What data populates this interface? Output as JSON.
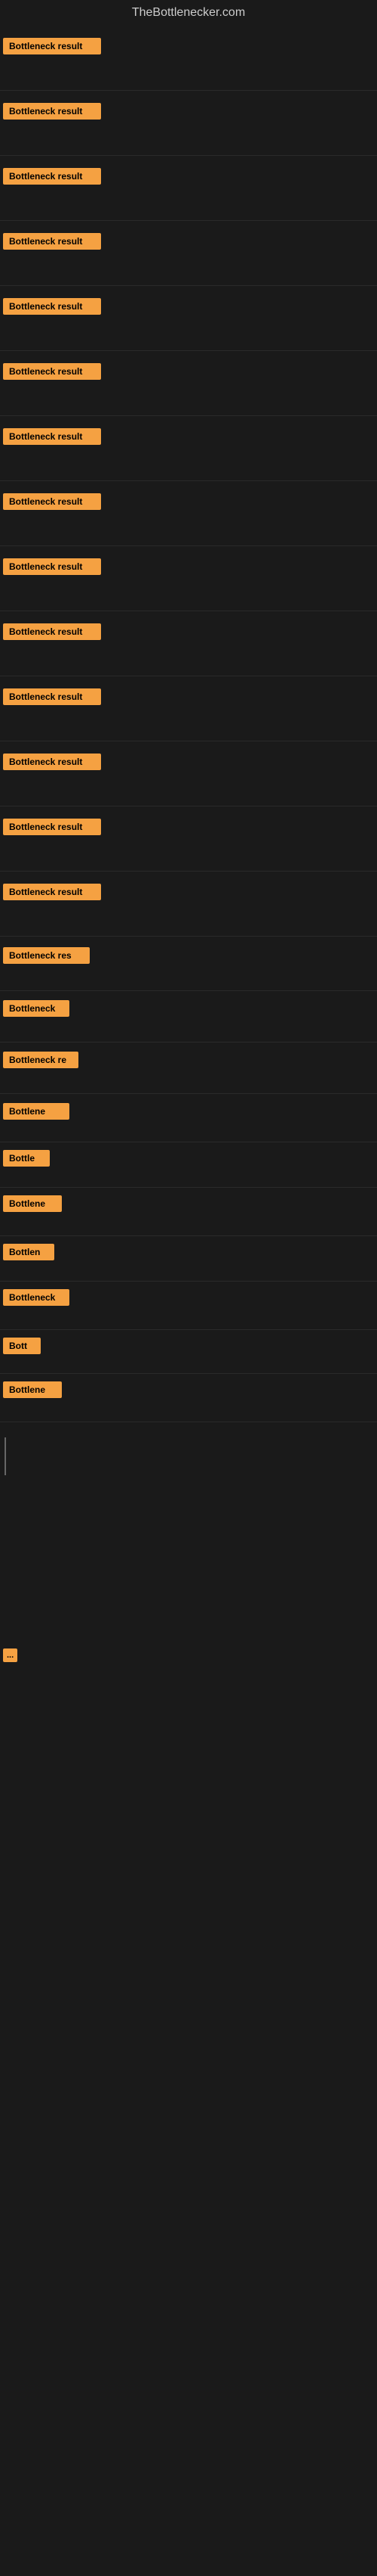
{
  "site": {
    "title": "TheBottlenecker.com"
  },
  "items": [
    {
      "id": 1,
      "label": "Bottleneck result",
      "class": "item-1",
      "height": 86
    },
    {
      "id": 2,
      "label": "Bottleneck result",
      "class": "item-2",
      "height": 86
    },
    {
      "id": 3,
      "label": "Bottleneck result",
      "class": "item-3",
      "height": 86
    },
    {
      "id": 4,
      "label": "Bottleneck result",
      "class": "item-4",
      "height": 86
    },
    {
      "id": 5,
      "label": "Bottleneck result",
      "class": "item-5",
      "height": 86
    },
    {
      "id": 6,
      "label": "Bottleneck result",
      "class": "item-6",
      "height": 86
    },
    {
      "id": 7,
      "label": "Bottleneck result",
      "class": "item-7",
      "height": 86
    },
    {
      "id": 8,
      "label": "Bottleneck result",
      "class": "item-8",
      "height": 86
    },
    {
      "id": 9,
      "label": "Bottleneck result",
      "class": "item-9",
      "height": 86
    },
    {
      "id": 10,
      "label": "Bottleneck result",
      "class": "item-10",
      "height": 86
    },
    {
      "id": 11,
      "label": "Bottleneck result",
      "class": "item-11",
      "height": 86
    },
    {
      "id": 12,
      "label": "Bottleneck result",
      "class": "item-12",
      "height": 86
    },
    {
      "id": 13,
      "label": "Bottleneck result",
      "class": "item-13",
      "height": 86
    },
    {
      "id": 14,
      "label": "Bottleneck result",
      "class": "item-14",
      "height": 86
    },
    {
      "id": 15,
      "label": "Bottleneck res",
      "class": "item-15",
      "height": 86
    },
    {
      "id": 16,
      "label": "Bottleneck",
      "class": "item-16",
      "height": 72
    },
    {
      "id": 17,
      "label": "Bottleneck re",
      "class": "item-17",
      "height": 72
    },
    {
      "id": 18,
      "label": "Bottlene",
      "class": "item-18",
      "height": 72
    },
    {
      "id": 19,
      "label": "Bottle",
      "class": "item-19",
      "height": 60
    },
    {
      "id": 20,
      "label": "Bottlene",
      "class": "item-20",
      "height": 60
    },
    {
      "id": 21,
      "label": "Bottlen",
      "class": "item-21",
      "height": 60
    },
    {
      "id": 22,
      "label": "Bottleneck",
      "class": "item-22",
      "height": 60
    },
    {
      "id": 23,
      "label": "Bott",
      "class": "item-23",
      "height": 60
    },
    {
      "id": 24,
      "label": "Bottlene",
      "class": "item-24",
      "height": 60
    }
  ],
  "colors": {
    "badge_bg": "#f5a142",
    "badge_text": "#000000",
    "page_bg": "#1a1a1a",
    "title_color": "#cccccc",
    "line_color": "#666666"
  }
}
